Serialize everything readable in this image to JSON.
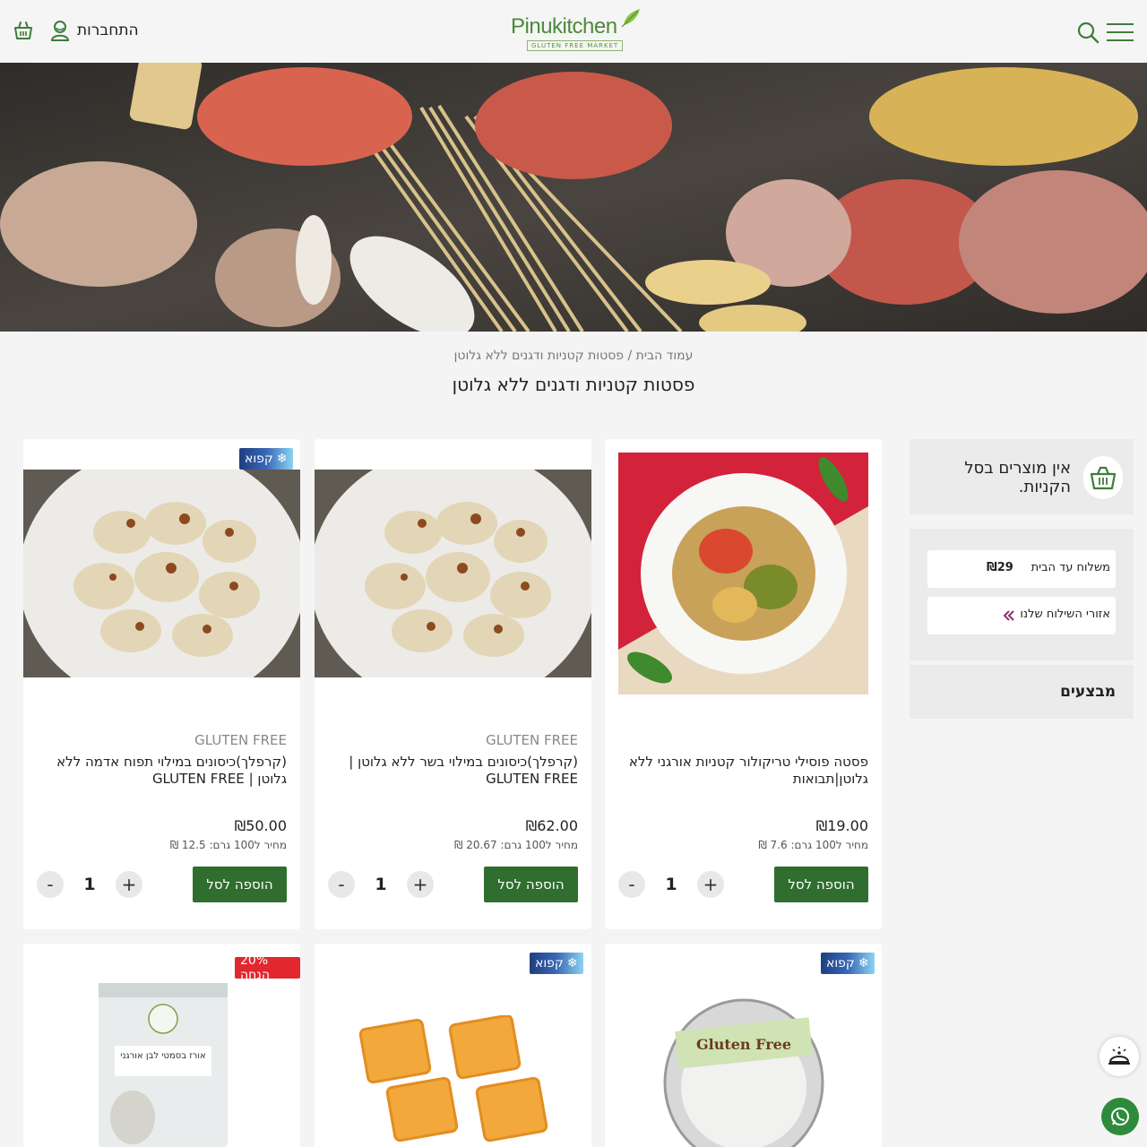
{
  "header": {
    "login_label": "התחברות",
    "logo_text": "Pinukitchen",
    "logo_subtitle": "GLUTEN FREE MARKET"
  },
  "breadcrumb": {
    "home": "עמוד הבית",
    "separator": " / ",
    "current": "פסטות קטניות ודגנים ללא גלוטן"
  },
  "page_title": "פסטות קטניות ודגנים ללא גלוטן",
  "sidebar": {
    "cart_empty": "אין מוצרים בסל הקניות.",
    "shipping_label": "משלוח עד הבית",
    "shipping_price": "₪29",
    "shipping_areas": "אזורי השילוח שלנו",
    "deals": "מבצעים"
  },
  "badges": {
    "frozen": "קפוא",
    "sale": "20% הנחה"
  },
  "products": [
    {
      "brand": "",
      "name": "פסטה פוסילי טריקולור קטניות אורגני ללא גלוטן|תבואות",
      "price": "₪19.00",
      "unit_price": "מחיר ל100 גרם: 7.6 ₪",
      "add_label": "הוספה לסל",
      "qty": "1",
      "frozen": false
    },
    {
      "brand": "GLUTEN FREE",
      "name": "(קרפלך)כיסונים במילוי בשר ללא גלוטן | GLUTEN FREE",
      "price": "₪62.00",
      "unit_price": "מחיר ל100 גרם: 20.67 ₪",
      "add_label": "הוספה לסל",
      "qty": "1",
      "frozen": false
    },
    {
      "brand": "GLUTEN FREE",
      "name": "(קרפלך)כיסונים במילוי תפוח אדמה ללא גלוטן | GLUTEN FREE",
      "price": "₪50.00",
      "unit_price": "מחיר ל100 גרם: 12.5 ₪",
      "add_label": "הוספה לסל",
      "qty": "1",
      "frozen": true
    }
  ],
  "qty_controls": {
    "plus": "+",
    "minus": "-"
  },
  "package_labels": {
    "rice": "אורז בסמטי לבן אורגני",
    "gluten_free": "Gluten Free"
  },
  "colors": {
    "brand_green": "#2f6e2e",
    "logo_green": "#4d8a3a",
    "sale_red": "#e0282e",
    "frozen_blue": "#1f3e80"
  }
}
